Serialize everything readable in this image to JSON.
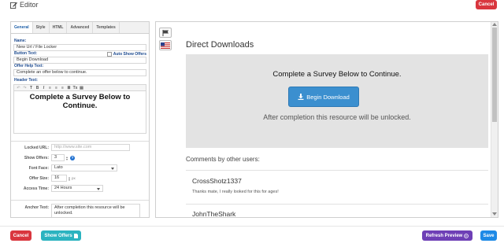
{
  "header": {
    "title": "Editor",
    "cancel_label": "Cancel"
  },
  "tabs": [
    {
      "label": "General"
    },
    {
      "label": "Style"
    },
    {
      "label": "HTML"
    },
    {
      "label": "Advanced"
    },
    {
      "label": "Templates"
    }
  ],
  "form": {
    "name_label": "Name:",
    "name_value": "New Url / File Locker",
    "button_text_label": "Button Text:",
    "auto_show_label": "Auto Show Offers",
    "button_text_value": "Begin Download",
    "offer_help_label": "Offer Help Text:",
    "offer_help_value": "Complete an offer below to continue.",
    "header_text_label": "Header Text:",
    "header_text_value": "Complete a Survey Below to Continue.",
    "locked_url_label": "Locked URL:",
    "locked_url_placeholder": "http://www.site.com",
    "show_offers_label": "Show Offers:",
    "show_offers_value": "3",
    "font_face_label": "Font Face:",
    "font_face_value": "Lato",
    "offer_size_label": "Offer Size:",
    "offer_size_value": "16",
    "offer_size_unit": "px",
    "access_time_label": "Access Time:",
    "access_time_value": "24 Hours",
    "anchor_text_label": "Anchor Text:",
    "anchor_text_value": "After completion this resource will be unlocked."
  },
  "preview": {
    "title": "Direct Downloads",
    "survey_title": "Complete a Survey Below to Continue.",
    "button_label": "Begin Download",
    "after_text": "After completion this resource will be unlocked.",
    "comments_heading": "Comments by other users:",
    "comments": [
      {
        "user": "CrossShotz1337",
        "text": "Thanks mate, I really looked for this for ages!"
      },
      {
        "user": "JohnTheShark",
        "text": ""
      }
    ]
  },
  "footer": {
    "cancel_label": "Cancel",
    "show_offers_label": "Show Offers",
    "refresh_label": "Refresh Preview",
    "save_label": "Save"
  },
  "colors": {
    "danger": "#d9363e",
    "teal": "#2bb3c0",
    "purple": "#6e3fb6",
    "primary": "#1e8ae6",
    "download_button": "#3b8fcf"
  },
  "icons": [
    "edit-icon",
    "flag-icon",
    "us-flag-icon",
    "download-icon",
    "document-icon",
    "refresh-icon",
    "help-icon"
  ]
}
